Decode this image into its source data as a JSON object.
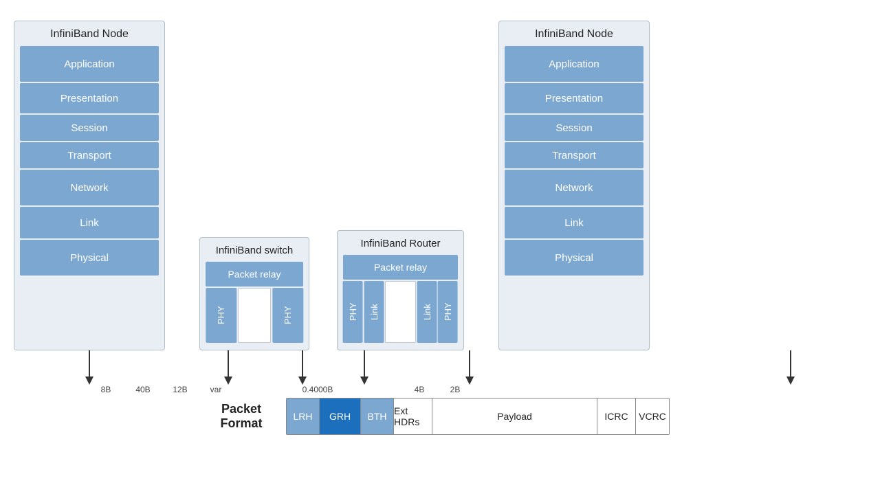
{
  "nodes": {
    "left_title": "InfiniBand Node",
    "right_title": "InfiniBand Node",
    "switch_title": "InfiniBand switch",
    "router_title": "InfiniBand Router",
    "layers": {
      "application": "Application",
      "presentation": "Presentation",
      "session": "Session",
      "transport": "Transport",
      "network": "Network",
      "link": "Link",
      "physical": "Physical",
      "packet_relay": "Packet relay",
      "phy": "PHY"
    }
  },
  "packet_format": {
    "label": "Packet\nFormat",
    "sizes": {
      "lrh": "8B",
      "grh": "40B",
      "bth": "12B",
      "ext": "var",
      "payload": "0.4000B",
      "icrc": "4B",
      "vcrc": "2B"
    },
    "fields": {
      "lrh": "LRH",
      "grh": "GRH",
      "bth": "BTH",
      "ext": "Ext HDRs",
      "payload": "Payload",
      "icrc": "ICRC",
      "vcrc": "VCRC"
    }
  }
}
